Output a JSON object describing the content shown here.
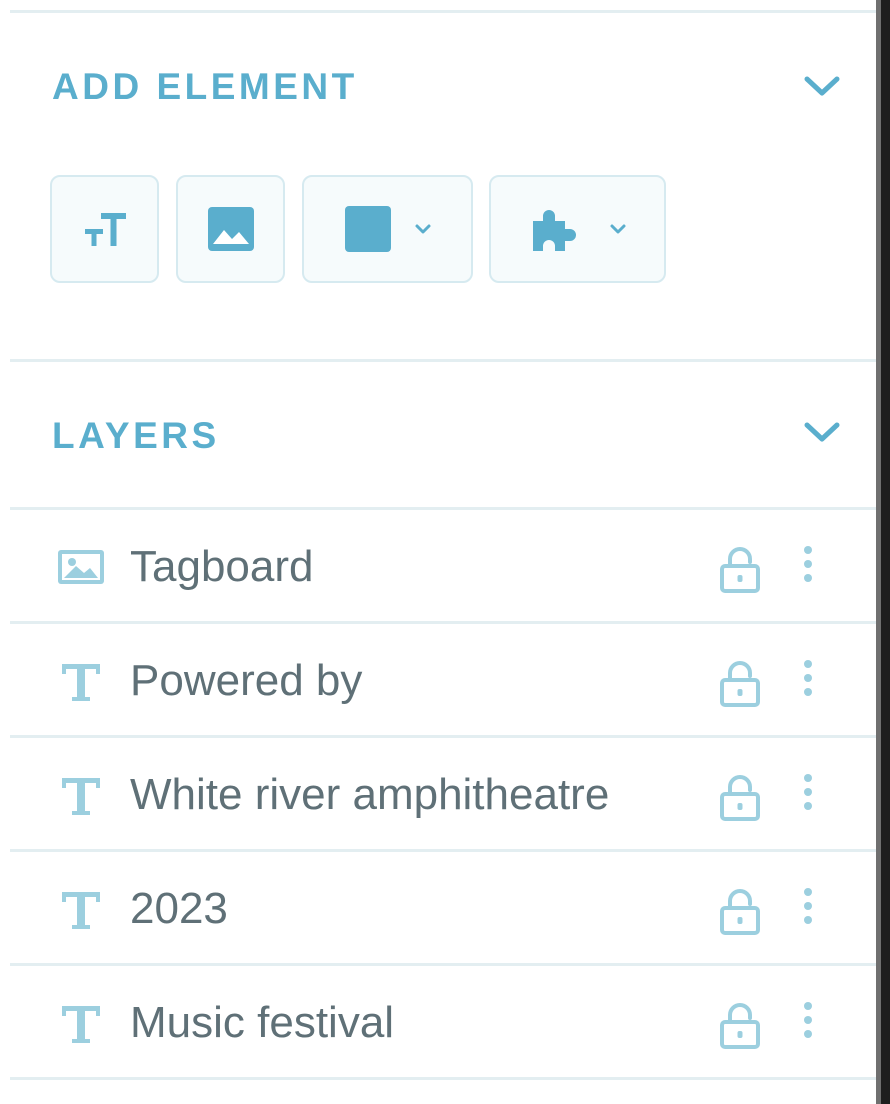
{
  "add_element": {
    "title": "ADD ELEMENT",
    "collapse_icon": "chevron-down-icon",
    "tools": [
      {
        "name": "text",
        "icon": "text-size-icon"
      },
      {
        "name": "image",
        "icon": "image-icon"
      },
      {
        "name": "shape",
        "icon": "square-icon",
        "dropdown_icon": "chevron-down-icon"
      },
      {
        "name": "widget",
        "icon": "puzzle-piece-icon",
        "dropdown_icon": "chevron-down-icon"
      }
    ]
  },
  "layers": {
    "title": "LAYERS",
    "collapse_icon": "chevron-down-icon",
    "items": [
      {
        "type": "image",
        "label": "Tagboard"
      },
      {
        "type": "text",
        "label": "Powered by"
      },
      {
        "type": "text",
        "label": "White river amphitheatre"
      },
      {
        "type": "text",
        "label": "2023"
      },
      {
        "type": "text",
        "label": "Music festival"
      }
    ]
  },
  "colors": {
    "accent": "#5aaecd",
    "icon_light": "#9ccfdf",
    "text": "#5f7077",
    "divider": "#e3eef1"
  }
}
